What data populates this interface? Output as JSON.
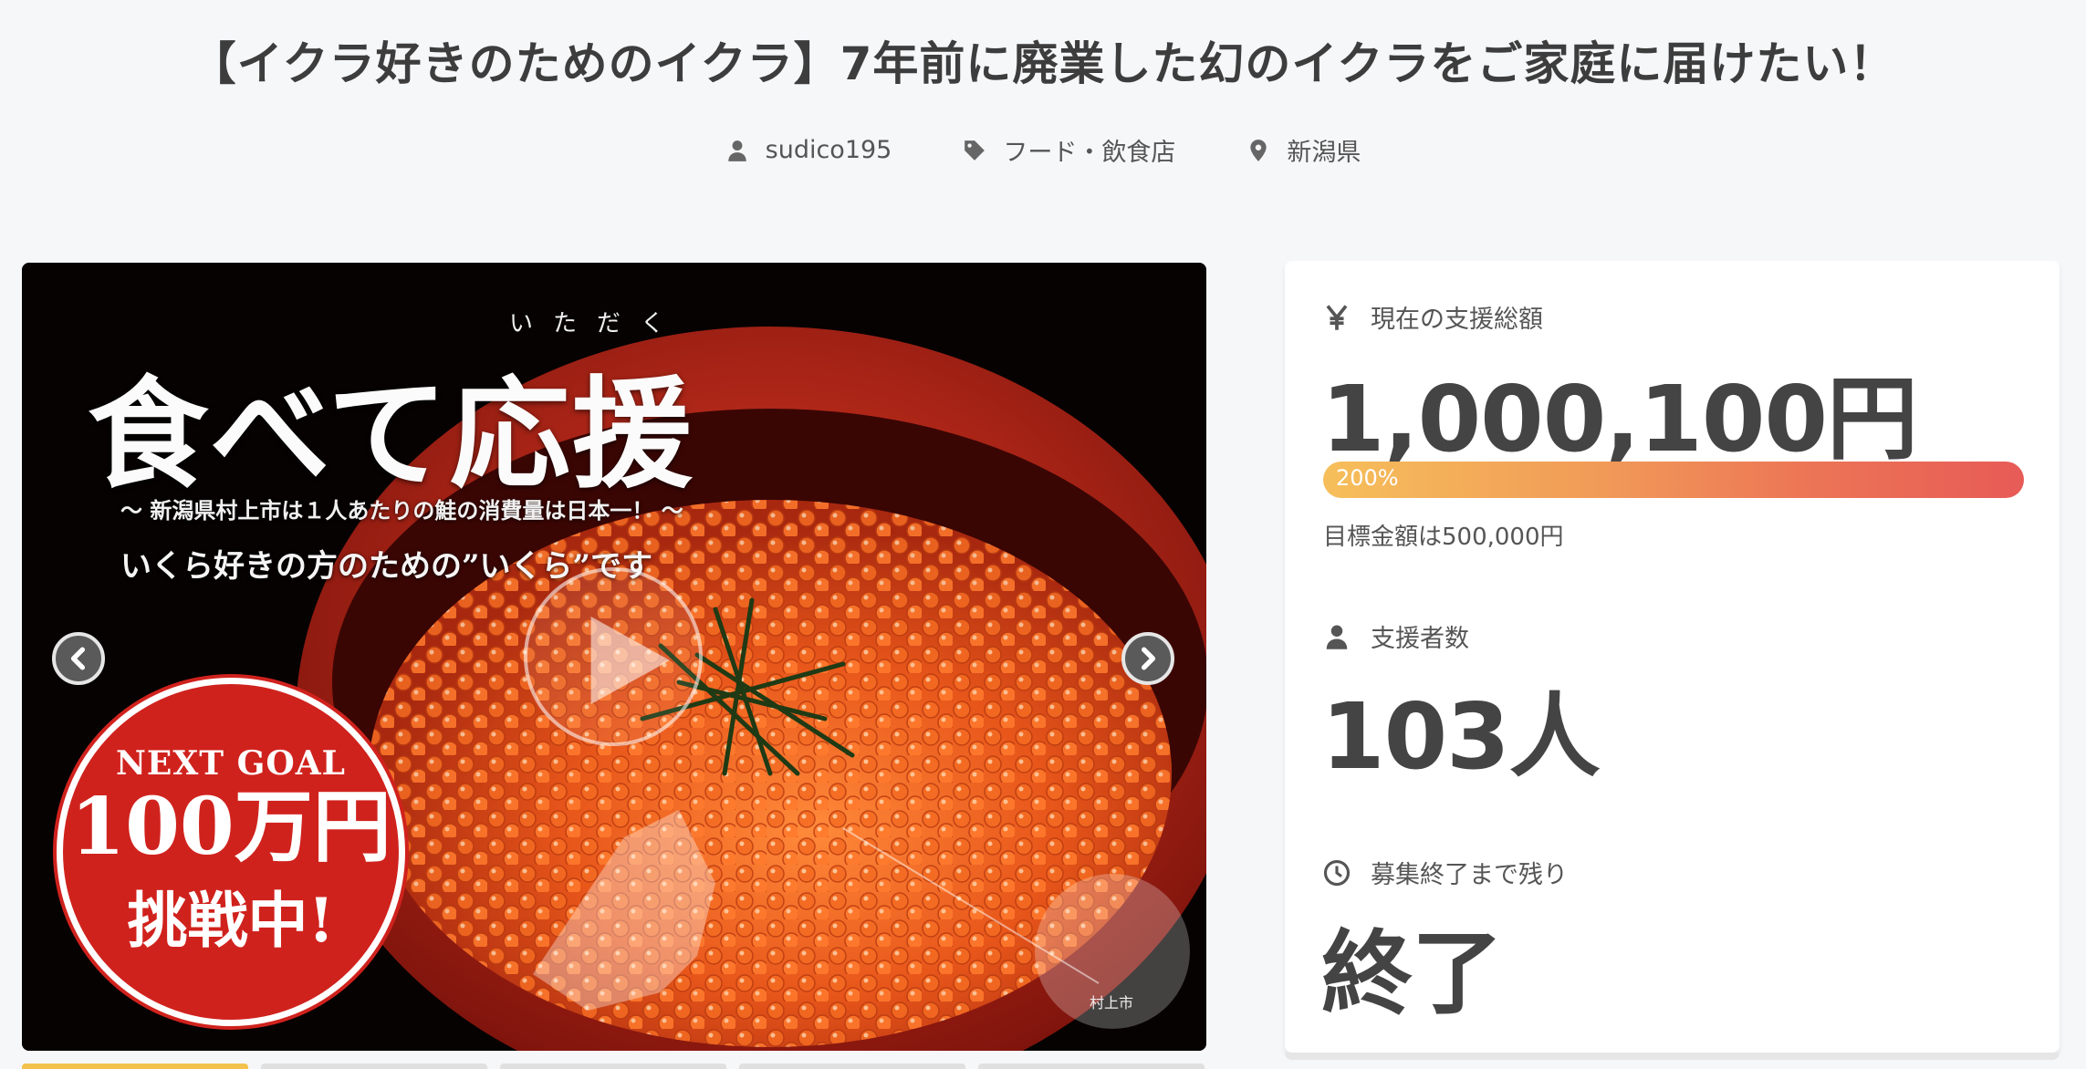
{
  "project": {
    "title": "【イクラ好きのためのイクラ】7年前に廃業した幻のイクラをご家庭に届けたい！",
    "owner": "sudico195",
    "category": "フード・飲食店",
    "location": "新潟県"
  },
  "hero_image": {
    "ruby": "いただく",
    "headline": "食べて応援",
    "subline1": "～ 新潟県村上市は１人あたりの鮭の消費量は日本一！ ～",
    "subline2": "いくら好きの方のための”いくら”です",
    "badge_line1": "NEXT GOAL",
    "badge_line2": "100万円",
    "badge_line3": "挑戦中!",
    "map_label": "村上市",
    "thumbnail_count": 5,
    "active_thumbnail": 0
  },
  "stats": {
    "total_label": "現在の支援総額",
    "total_amount": "1,000,100円",
    "progress_text": "200%",
    "progress_percent": 200,
    "goal_text": "目標金額は500,000円",
    "backers_label": "支援者数",
    "backers_value": "103人",
    "remaining_label": "募集終了まで残り",
    "remaining_value": "終了"
  },
  "icons": {
    "owner": "user-icon",
    "category": "tag-icon",
    "location": "map-pin-icon",
    "total": "yen-icon",
    "backers": "user-icon",
    "remaining": "clock-icon",
    "prev": "chevron-left-icon",
    "next": "chevron-right-icon",
    "play": "play-icon"
  },
  "colors": {
    "background": "#f6f7f9",
    "progress_start": "#f6bf5a",
    "progress_end": "#e75b56",
    "badge_red": "#d0221d",
    "active_thumb": "#f3c24d"
  }
}
